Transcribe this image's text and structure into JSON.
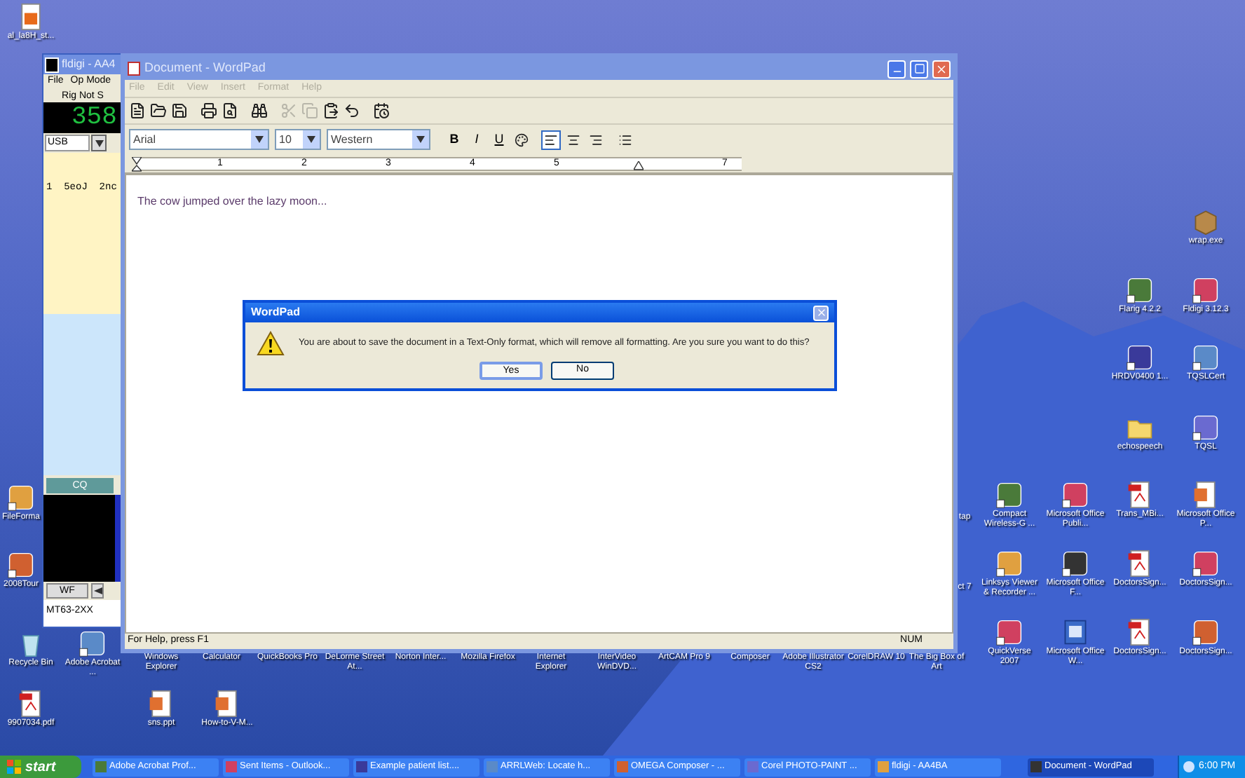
{
  "desktop_icons": [
    {
      "label": "al_la8H_st...",
      "kind": "doc"
    },
    {
      "label": "wrap.exe",
      "kind": "box"
    },
    {
      "label": "Flarig 4.2.2",
      "kind": "app"
    },
    {
      "label": "Fldigi 3.12.3",
      "kind": "app"
    },
    {
      "label": "HRDV0400 1...",
      "kind": "app"
    },
    {
      "label": "TQSLCert",
      "kind": "app"
    },
    {
      "label": "echospeech",
      "kind": "folder"
    },
    {
      "label": "TQSL",
      "kind": "app"
    },
    {
      "label": "FileForma",
      "kind": "app"
    },
    {
      "label": "tap",
      "kind": "none"
    },
    {
      "label": "Compact Wireless-G ...",
      "kind": "app"
    },
    {
      "label": "Microsoft Office Publi...",
      "kind": "app"
    },
    {
      "label": "Trans_MBi...",
      "kind": "pdf"
    },
    {
      "label": "Microsoft Office P...",
      "kind": "ppt"
    },
    {
      "label": "2008Tour",
      "kind": "app"
    },
    {
      "label": "ct 7",
      "kind": "none"
    },
    {
      "label": "Linksys Viewer & Recorder ...",
      "kind": "app"
    },
    {
      "label": "Microsoft Office F...",
      "kind": "app"
    },
    {
      "label": "DoctorsSign...",
      "kind": "pdf"
    },
    {
      "label": "DoctorsSign...",
      "kind": "app"
    },
    {
      "label": "Recycle Bin",
      "kind": "recycle"
    },
    {
      "label": "Adobe Acrobat ...",
      "kind": "app"
    },
    {
      "label": "Windows Explorer",
      "kind": "none"
    },
    {
      "label": "Calculator",
      "kind": "none"
    },
    {
      "label": "QuickBooks Pro",
      "kind": "none"
    },
    {
      "label": "DeLorme Street At...",
      "kind": "none"
    },
    {
      "label": "Norton Inter...",
      "kind": "none"
    },
    {
      "label": "Mozilla Firefox",
      "kind": "none"
    },
    {
      "label": "Internet Explorer",
      "kind": "none"
    },
    {
      "label": "InterVideo WinDVD...",
      "kind": "none"
    },
    {
      "label": "ArtCAM Pro 9",
      "kind": "none"
    },
    {
      "label": "Composer",
      "kind": "none"
    },
    {
      "label": "Adobe Illustrator CS2",
      "kind": "none"
    },
    {
      "label": "CorelDRAW 10",
      "kind": "none"
    },
    {
      "label": "The Big Box of Art",
      "kind": "none"
    },
    {
      "label": "QuickVerse 2007",
      "kind": "app"
    },
    {
      "label": "Microsoft Office W...",
      "kind": "word"
    },
    {
      "label": "DoctorsSign...",
      "kind": "pdf"
    },
    {
      "label": "DoctorsSign...",
      "kind": "app"
    },
    {
      "label": "9907034.pdf",
      "kind": "pdf"
    },
    {
      "label": "sns.ppt",
      "kind": "ppt"
    },
    {
      "label": "How-to-V-M...",
      "kind": "ppt"
    }
  ],
  "fldigi": {
    "title": "fldigi - AA4",
    "menu": [
      "File",
      "Op Mode"
    ],
    "rig_status": "Rig Not S",
    "frequency": "358",
    "mode": "USB",
    "channel_text": "1  5eoJ  2nc",
    "cq_button": "CQ",
    "wf_button": "WF",
    "modem": "MT63-2XX"
  },
  "wordpad": {
    "title": "Document - WordPad",
    "menu": [
      "File",
      "Edit",
      "View",
      "Insert",
      "Format",
      "Help"
    ],
    "toolbar": [
      {
        "kind": "new",
        "disabled": false
      },
      {
        "kind": "open",
        "disabled": false
      },
      {
        "kind": "save",
        "disabled": false
      },
      {
        "kind": "print",
        "disabled": false
      },
      {
        "kind": "preview",
        "disabled": false
      },
      {
        "kind": "find",
        "disabled": false
      },
      {
        "kind": "cut",
        "disabled": true
      },
      {
        "kind": "copy",
        "disabled": true
      },
      {
        "kind": "paste",
        "disabled": false
      },
      {
        "kind": "undo",
        "disabled": false
      },
      {
        "kind": "datetime",
        "disabled": false
      }
    ],
    "font": "Arial",
    "size": "10",
    "script": "Western",
    "format_buttons": [
      {
        "kind": "bold",
        "label": "B",
        "selected": false
      },
      {
        "kind": "italic",
        "label": "I",
        "selected": false
      },
      {
        "kind": "underline",
        "label": "U",
        "selected": false
      },
      {
        "kind": "color",
        "selected": false
      },
      {
        "kind": "align-left",
        "selected": true
      },
      {
        "kind": "align-center",
        "selected": false
      },
      {
        "kind": "align-right",
        "selected": false
      },
      {
        "kind": "bullets",
        "selected": false
      }
    ],
    "ruler_numbers": [
      "1",
      "2",
      "3",
      "4",
      "5",
      "7"
    ],
    "document_text": "The cow jumped over the lazy moon...",
    "status_text": "For Help, press F1",
    "status_num": "NUM"
  },
  "dialog": {
    "title": "WordPad",
    "message": "You are about to save the document in a Text-Only format, which will remove all formatting. Are you sure you want to do this?",
    "buttons": [
      {
        "label": "Yes",
        "selected": true
      },
      {
        "label": "No",
        "selected": false
      }
    ]
  },
  "taskbar": {
    "start": "start",
    "tasks": [
      {
        "label": "Adobe Acrobat Prof...",
        "selected": false
      },
      {
        "label": "Sent Items - Outlook...",
        "selected": false
      },
      {
        "label": "Example patient list....",
        "selected": false
      },
      {
        "label": "ARRLWeb: Locate h...",
        "selected": false
      },
      {
        "label": "OMEGA Composer - ...",
        "selected": false
      },
      {
        "label": "Corel PHOTO-PAINT ...",
        "selected": false
      },
      {
        "label": "fldigi - AA4BA",
        "selected": false
      },
      {
        "label": "Document - WordPad",
        "selected": true
      }
    ],
    "clock": "6:00 PM"
  }
}
